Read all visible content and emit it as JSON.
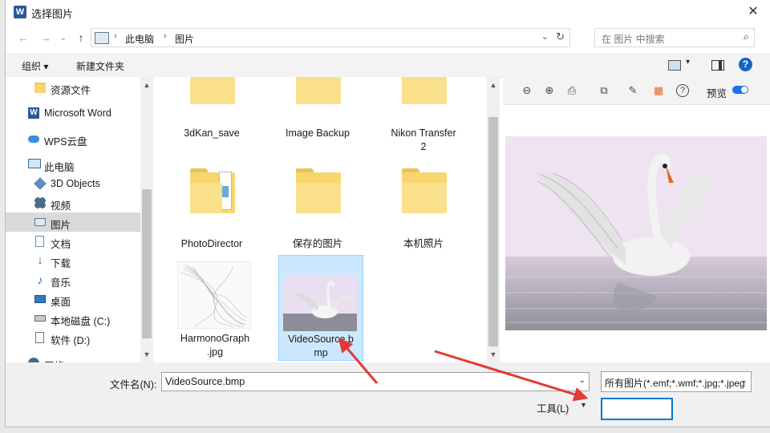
{
  "window": {
    "title": "选择图片",
    "app_icon": "W",
    "close_glyph": "✕"
  },
  "nav": {
    "back_glyph": "←",
    "forward_glyph": "→",
    "dropdown_glyph": "⌄",
    "up_glyph": "↑",
    "breadcrumb": [
      "此电脑",
      "图片"
    ],
    "separator": "›",
    "address_dropdown_glyph": "⌄",
    "refresh_glyph": "↻",
    "search_placeholder": "在 图片 中搜索",
    "search_glyph": "⌕"
  },
  "toolbar": {
    "organize_label": "组织 ▾",
    "new_folder_label": "新建文件夹",
    "help_glyph": "?",
    "view_dropdown_glyph": "▾"
  },
  "sidebar": {
    "items": [
      {
        "label": "资源文件",
        "icon": "folder-icon"
      },
      {
        "label": "Microsoft Word",
        "icon": "word-icon"
      },
      {
        "label": "WPS云盘",
        "icon": "cloud-icon"
      },
      {
        "label": "此电脑",
        "icon": "computer-icon"
      },
      {
        "label": "3D Objects",
        "icon": "cube-icon"
      },
      {
        "label": "视频",
        "icon": "video-icon"
      },
      {
        "label": "图片",
        "icon": "pictures-icon",
        "selected": true
      },
      {
        "label": "文档",
        "icon": "document-icon"
      },
      {
        "label": "下载",
        "icon": "download-icon"
      },
      {
        "label": "音乐",
        "icon": "music-icon"
      },
      {
        "label": "桌面",
        "icon": "desktop-icon"
      },
      {
        "label": "本地磁盘 (C:)",
        "icon": "drive-icon"
      },
      {
        "label": "软件 (D:)",
        "icon": "drive-icon"
      },
      {
        "label": "网络",
        "icon": "network-icon"
      }
    ],
    "scroll_up_glyph": "▲",
    "scroll_down_glyph": "▼"
  },
  "files": {
    "items": [
      {
        "label_lines": [
          "3dKan_save",
          ""
        ],
        "type": "folder"
      },
      {
        "label_lines": [
          "Image Backup",
          ""
        ],
        "type": "folder"
      },
      {
        "label_lines": [
          "Nikon Transfer",
          "2"
        ],
        "type": "folder"
      },
      {
        "label_lines": [
          "PhotoDirector",
          ""
        ],
        "type": "folder-docs"
      },
      {
        "label_lines": [
          "保存的图片",
          ""
        ],
        "type": "folder"
      },
      {
        "label_lines": [
          "本机照片",
          ""
        ],
        "type": "folder"
      },
      {
        "label_lines": [
          "HarmonoGraph",
          ".jpg"
        ],
        "type": "image-graph"
      },
      {
        "label_lines": [
          "VideoSource.b",
          "mp"
        ],
        "type": "image-swan",
        "selected": true
      }
    ],
    "scroll_up_glyph": "▲",
    "scroll_down_glyph": "▼"
  },
  "preview": {
    "tool_icons": [
      "zoom-out-icon",
      "zoom-in-icon",
      "print-icon",
      "copy-icon",
      "edit-image-icon",
      "apps-icon",
      "help-icon"
    ],
    "tool_glyphs": [
      "⊖",
      "⊕",
      "⎙",
      "⧉",
      "✎",
      "▦",
      "?"
    ],
    "preview_label": "预览",
    "toggle_on": true
  },
  "footer": {
    "filename_label": "文件名(N):",
    "filename_value": "VideoSource.bmp",
    "filetype_value": "所有图片(*.emf;*.wmf;*.jpg;*.jpeg",
    "tools_label": "工具(L)",
    "dropdown_glyph": "⌄",
    "tools_dd_glyph": "▼"
  },
  "colors": {
    "accent": "#0078d7",
    "selection_bg": "#cce8ff",
    "annotation_arrow": "#e53935"
  }
}
